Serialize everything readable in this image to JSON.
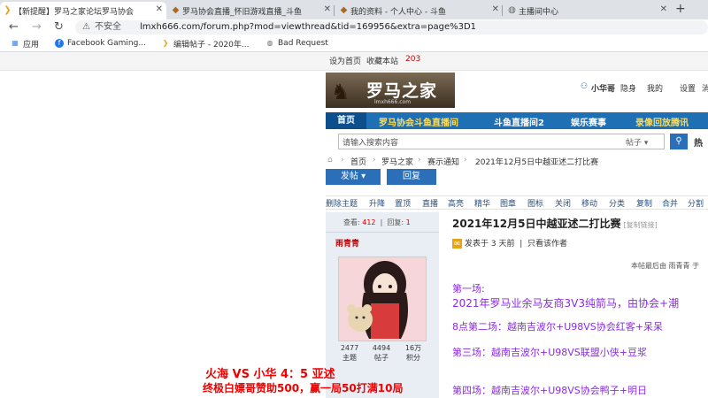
{
  "tabs": [
    {
      "title": "【新提醒】罗马之家论坛罗马协会",
      "icon": "forum-icon",
      "active": true
    },
    {
      "title": "罗马协会直播_怀旧游戏直播_斗鱼",
      "icon": "game-icon",
      "active": false
    },
    {
      "title": "我的资料 - 个人中心 - 斗鱼",
      "icon": "game-icon",
      "active": false
    },
    {
      "title": "主播间中心",
      "icon": "globe-icon",
      "active": false
    }
  ],
  "address": {
    "security": "不安全",
    "url": "lmxh666.com/forum.php?mod=viewthread&tid=169956&extra=page%3D1"
  },
  "bookmarks": [
    {
      "label": "应用",
      "icon": "apps-icon"
    },
    {
      "label": "Facebook Gaming...",
      "icon": "facebook-icon"
    },
    {
      "label": "编辑帖子 - 2020年...",
      "icon": "forum-icon"
    },
    {
      "label": "Bad Request",
      "icon": "globe-icon"
    }
  ],
  "topstrip": {
    "set_home": "设为首页",
    "favorite": "收藏本站",
    "favorite_count": "203"
  },
  "logo": {
    "text": "罗马之家",
    "sub": "lmxh666.com"
  },
  "userbar": {
    "user": "小华哥",
    "status": "隐身",
    "my": "我的",
    "settings": "设置",
    "messages": "消"
  },
  "nav": {
    "items": [
      "首页",
      "罗马协会斗鱼直播间",
      "斗鱼直播间2",
      "娱乐赛事",
      "录像回放腾讯"
    ]
  },
  "search": {
    "placeholder": "请输入搜索内容",
    "scope": "帖子",
    "hot": "热"
  },
  "breadcrumb": {
    "items": [
      "首页",
      "罗马之家",
      "赛示通知",
      "2021年12月5日中越亚述二打比赛"
    ]
  },
  "actions": {
    "post": "发帖",
    "reply": "回复"
  },
  "modbar": {
    "items": [
      "删除主题",
      "升降",
      "置顶",
      "直播",
      "高亮",
      "精华",
      "图章",
      "图标",
      "关闭",
      "移动",
      "分类",
      "复制",
      "合并",
      "分割"
    ]
  },
  "author": {
    "views_label": "查看:",
    "views": "412",
    "replies_label": "回复:",
    "replies": "1",
    "name": "雨青青",
    "stats": [
      {
        "value": "2477",
        "label": "主题"
      },
      {
        "value": "4494",
        "label": "帖子"
      },
      {
        "value": "16万",
        "label": "积分"
      }
    ]
  },
  "post": {
    "title": "2021年12月5日中越亚述二打比赛",
    "copy_link": "[复制链接]",
    "posted_prefix": "发表于",
    "posted_time": "3 天前",
    "author_only": "只看该作者",
    "edit_note": "本帖最后由 雨青青 于",
    "lines": [
      "第一场:",
      "2021年罗马业余马友商3V3纯箭马，由协会+潮",
      "8点第二场：越南吉波尔+U98VS协会红客+呆呆",
      "第三场：越南吉波尔+U98VS联盟小侠+豆浆",
      "第四场：越南吉波尔+U98VS协会鸭子+明日"
    ]
  },
  "overlay": {
    "line1": "火海  VS  小华   4：5   亚述",
    "line2": "终极白嫖哥赞助500，赢一局50打满10局"
  }
}
